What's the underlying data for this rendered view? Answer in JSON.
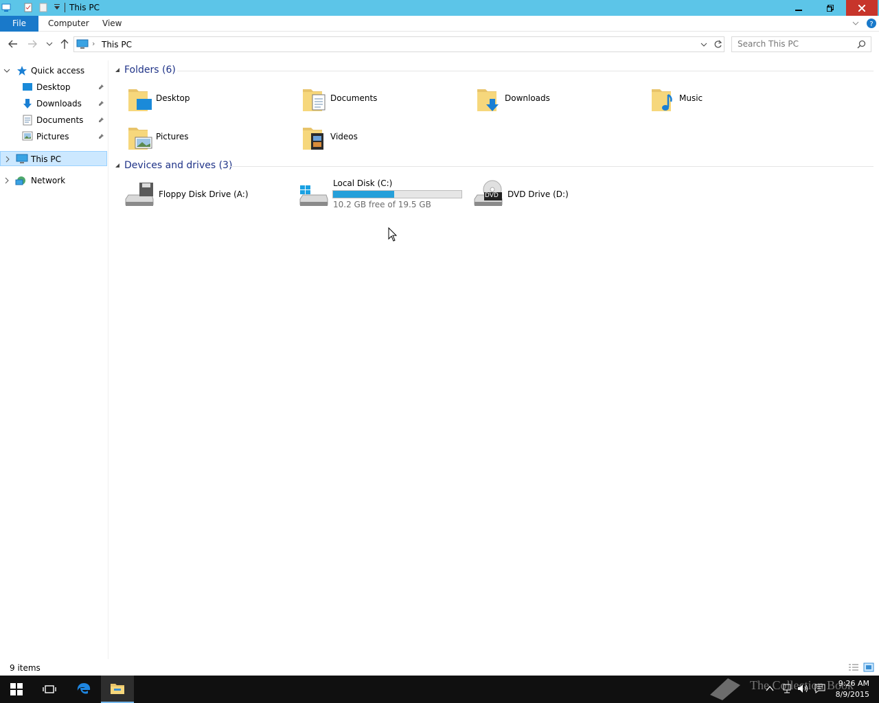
{
  "window": {
    "title": "This PC",
    "minimize_icon": "minimize-icon",
    "maximize_icon": "restore-icon",
    "close_icon": "close-icon"
  },
  "ribbon": {
    "tabs": [
      {
        "label": "File"
      },
      {
        "label": "Computer"
      },
      {
        "label": "View"
      }
    ]
  },
  "address": {
    "breadcrumb": "This PC",
    "search_placeholder": "Search This PC"
  },
  "navpane": {
    "quick_access": "Quick access",
    "items": [
      {
        "label": "Desktop",
        "icon": "desktop-icon",
        "pinned": true
      },
      {
        "label": "Downloads",
        "icon": "downloads-icon",
        "pinned": true
      },
      {
        "label": "Documents",
        "icon": "documents-icon",
        "pinned": true
      },
      {
        "label": "Pictures",
        "icon": "pictures-icon",
        "pinned": true
      }
    ],
    "this_pc": "This PC",
    "network": "Network"
  },
  "folders": {
    "heading": "Folders (6)",
    "items": [
      {
        "label": "Desktop",
        "icon": "desktop-folder-icon"
      },
      {
        "label": "Documents",
        "icon": "documents-folder-icon"
      },
      {
        "label": "Downloads",
        "icon": "downloads-folder-icon"
      },
      {
        "label": "Music",
        "icon": "music-folder-icon"
      },
      {
        "label": "Pictures",
        "icon": "pictures-folder-icon"
      },
      {
        "label": "Videos",
        "icon": "videos-folder-icon"
      }
    ]
  },
  "drives": {
    "heading": "Devices and drives (3)",
    "items": [
      {
        "label": "Floppy Disk Drive (A:)",
        "icon": "floppy-drive-icon"
      },
      {
        "label": "Local Disk (C:)",
        "icon": "local-disk-icon",
        "free": "10.2 GB free of 19.5 GB",
        "used_fraction": 0.477
      },
      {
        "label": "DVD Drive (D:)",
        "icon": "dvd-drive-icon",
        "dvd_badge": "DVD"
      }
    ]
  },
  "status": {
    "count": "9 items"
  },
  "taskbar": {
    "time": "9:26 AM",
    "date": "8/9/2015",
    "watermark": "The Collection Book"
  },
  "colors": {
    "titlebar": "#5cc5e8",
    "accent": "#1979ca",
    "heading": "#1e3287",
    "drive_fill": "#26a0da",
    "selection": "#cce8ff"
  }
}
